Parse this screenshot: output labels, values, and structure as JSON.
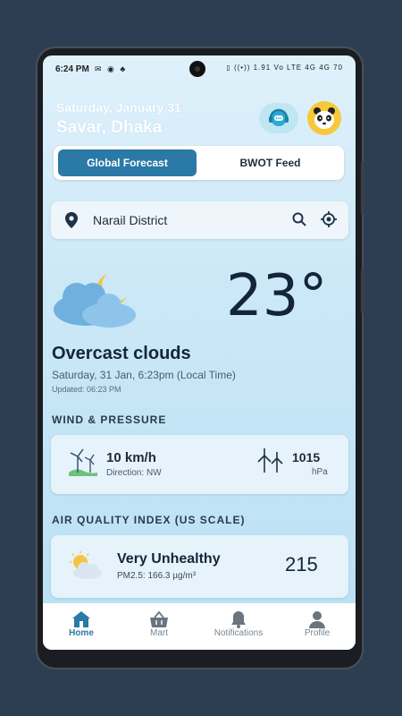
{
  "status_bar": {
    "time": "6:24 PM",
    "notif_icons": "✉ ◉ ♣",
    "right_icons": "▯ ((•)) 1.91 Vo LTE 4G 4G 70"
  },
  "header": {
    "date": "Saturday, January 31",
    "city": "Savar, Dhaka"
  },
  "tabs": [
    {
      "label": "Global Forecast",
      "active": true
    },
    {
      "label": "BWOT Feed",
      "active": false
    }
  ],
  "search": {
    "location": "Narail District"
  },
  "weather": {
    "temperature": "23°",
    "condition": "Overcast clouds",
    "local_time": "Saturday, 31 Jan, 6:23pm (Local Time)",
    "updated": "Updated: 06:23 PM",
    "icon": "cloudy-moon-icon"
  },
  "wind_section": {
    "title": "WIND & PRESSURE",
    "speed": "10 km/h",
    "direction": "Direction: NW",
    "pressure": "1015",
    "pressure_unit": "hPa"
  },
  "aqi_section": {
    "title": "AIR QUALITY INDEX (US SCALE)",
    "label": "Very Unhealthy",
    "pm": "PM2.5: 166.3 µg/m³",
    "value": "215"
  },
  "nav": [
    {
      "label": "Home",
      "icon": "home-icon",
      "active": true
    },
    {
      "label": "Mart",
      "icon": "basket-icon"
    },
    {
      "label": "Notifications",
      "icon": "bell-icon"
    },
    {
      "label": "Profile",
      "icon": "person-icon"
    }
  ],
  "colors": {
    "accent": "#2a79a6",
    "bg_top": "#dff1fb",
    "text_dark": "#14253a"
  }
}
